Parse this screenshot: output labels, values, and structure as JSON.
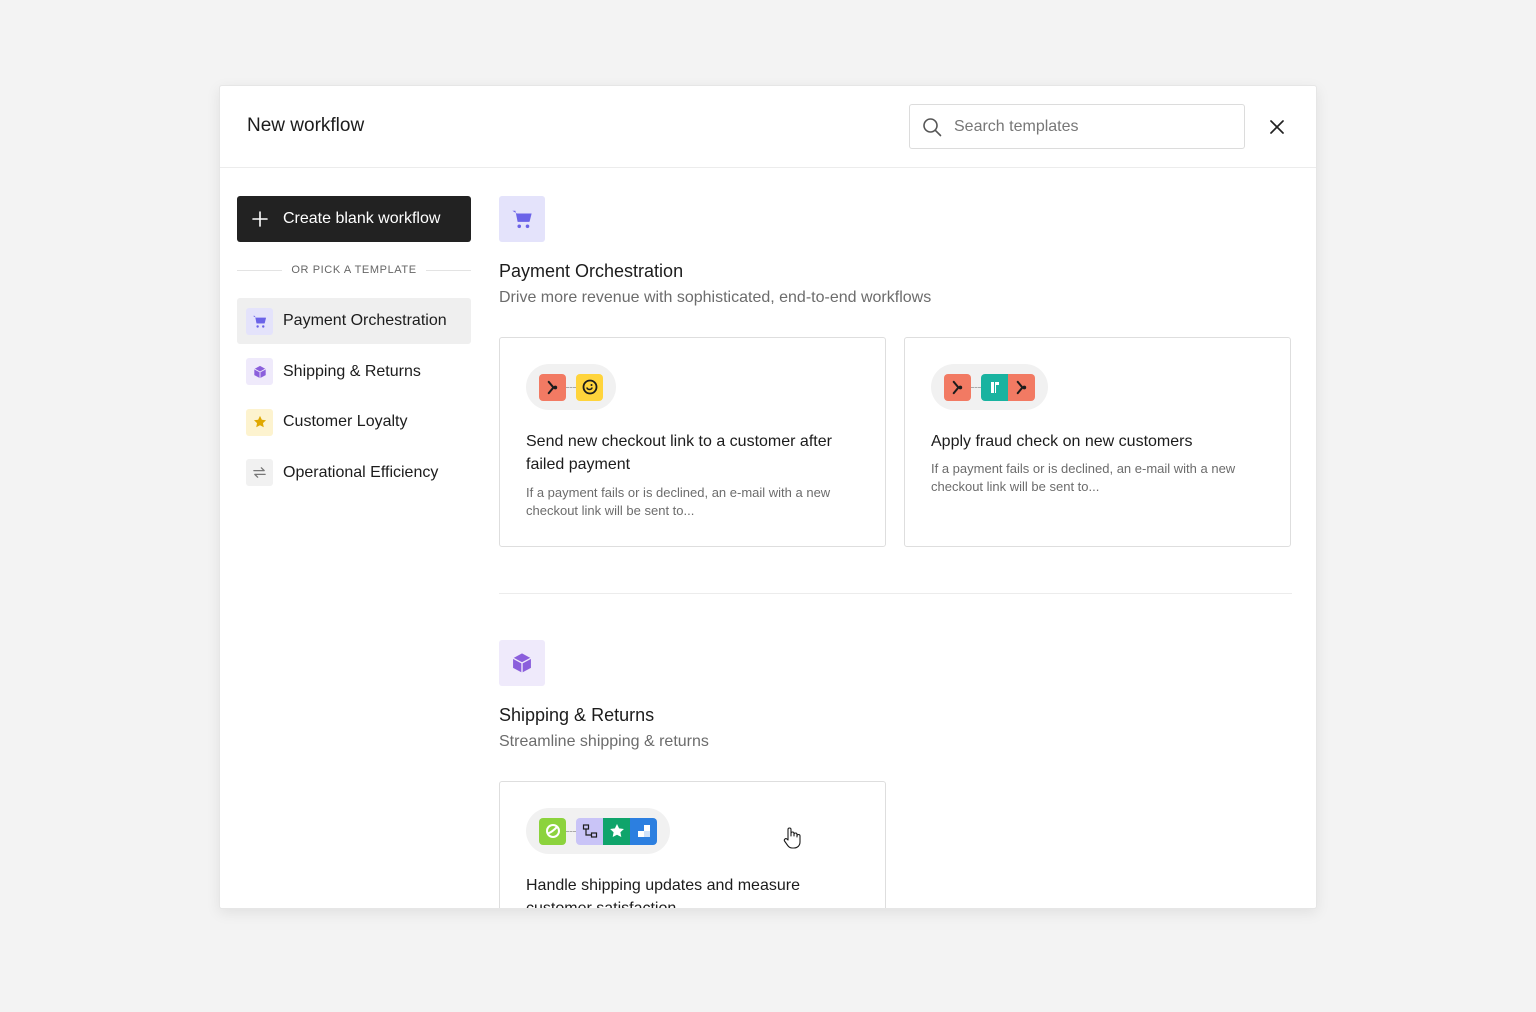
{
  "header": {
    "title": "New workflow",
    "search_placeholder": "Search templates"
  },
  "sidebar": {
    "blank_button_label": "Create blank workflow",
    "divider_label": "OR PICK A TEMPLATE",
    "items": [
      {
        "label": "Payment Orchestration",
        "icon": "cart-icon",
        "active": true
      },
      {
        "label": "Shipping & Returns",
        "icon": "box-icon",
        "active": false
      },
      {
        "label": "Customer Loyalty",
        "icon": "star-icon",
        "active": false
      },
      {
        "label": "Operational Efficiency",
        "icon": "repeat-icon",
        "active": false
      }
    ]
  },
  "sections": [
    {
      "title": "Payment Orchestration",
      "subtitle": "Drive more revenue with sophisticated, end-to-end workflows",
      "icon": "cart-icon",
      "cards": [
        {
          "title": "Send new checkout link to a customer after failed payment",
          "description": "If a payment fails or is declined, an e-mail with a new checkout link will be sent to...",
          "apps": [
            "payment-app-icon",
            "mailchimp-icon"
          ]
        },
        {
          "title": "Apply fraud check on new customers",
          "description": "If a payment fails or is declined, an e-mail with a new checkout link will be sent to...",
          "apps": [
            "payment-app-icon",
            "fraud-app-icon",
            "payment-app-icon"
          ]
        }
      ]
    },
    {
      "title": "Shipping & Returns",
      "subtitle": "Streamline shipping & returns",
      "icon": "box-icon",
      "cards": [
        {
          "title": "Handle shipping updates and measure customer satisfaction",
          "apps": [
            "shipping-app-icon",
            "workflow-app-icon",
            "trustpilot-icon",
            "grid-app-icon"
          ]
        }
      ]
    }
  ],
  "colors": {
    "primary_button": "#222222",
    "payment_accent": "#6b63e8",
    "shipping_accent": "#8b5fdc",
    "loyalty_accent": "#e0a800",
    "app_red": "#f27a63",
    "app_yellow": "#ffd43b",
    "app_teal": "#19b3a0",
    "app_green": "#8cd33d",
    "app_star_green": "#0fa46b",
    "app_blue": "#2c7fe0"
  }
}
